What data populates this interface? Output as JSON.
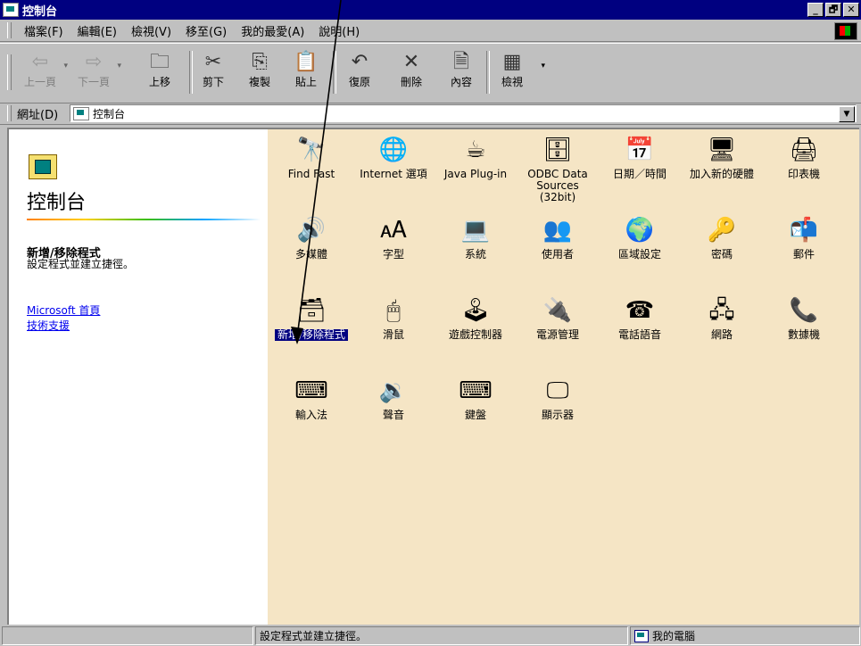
{
  "window": {
    "title": "控制台",
    "buttons": [
      "_",
      "🗗",
      "✕"
    ]
  },
  "menubar": {
    "items": [
      "檔案(F)",
      "編輯(E)",
      "檢視(V)",
      "移至(G)",
      "我的最愛(A)",
      "說明(H)"
    ]
  },
  "toolbar": {
    "back": "上一頁",
    "forward": "下一頁",
    "up": "上移",
    "cut": "剪下",
    "copy": "複製",
    "paste": "貼上",
    "undo": "復原",
    "delete": "刪除",
    "properties": "內容",
    "views": "檢視"
  },
  "address": {
    "label": "網址(D)",
    "value": "控制台"
  },
  "leftpane": {
    "title": "控制台",
    "selected_title": "新增/移除程式",
    "selected_desc": "設定程式並建立捷徑。",
    "links": [
      "Microsoft 首頁",
      "技術支援"
    ]
  },
  "icons": [
    {
      "label": "Find Fast",
      "glyph": "🔭",
      "icon": "find-fast-icon"
    },
    {
      "label": "Internet 選項",
      "glyph": "🌐",
      "icon": "internet-options-icon"
    },
    {
      "label": "Java Plug-in",
      "glyph": "☕",
      "icon": "java-plugin-icon"
    },
    {
      "label": "ODBC Data Sources (32bit)",
      "glyph": "🗄",
      "icon": "odbc-icon"
    },
    {
      "label": "日期／時間",
      "glyph": "📅",
      "icon": "date-time-icon"
    },
    {
      "label": "加入新的硬體",
      "glyph": "🖥",
      "icon": "add-hardware-icon"
    },
    {
      "label": "印表機",
      "glyph": "🖨",
      "icon": "printers-icon"
    },
    {
      "label": "多媒體",
      "glyph": "🔊",
      "icon": "multimedia-icon"
    },
    {
      "label": "字型",
      "glyph": "🗚",
      "icon": "fonts-icon"
    },
    {
      "label": "系統",
      "glyph": "💻",
      "icon": "system-icon"
    },
    {
      "label": "使用者",
      "glyph": "👥",
      "icon": "users-icon"
    },
    {
      "label": "區域設定",
      "glyph": "🌍",
      "icon": "regional-settings-icon"
    },
    {
      "label": "密碼",
      "glyph": "🔑",
      "icon": "passwords-icon"
    },
    {
      "label": "郵件",
      "glyph": "📬",
      "icon": "mail-icon"
    },
    {
      "label": "新增/移除程式",
      "glyph": "🗃",
      "icon": "add-remove-programs-icon",
      "selected": true
    },
    {
      "label": "滑鼠",
      "glyph": "🖱",
      "icon": "mouse-icon"
    },
    {
      "label": "遊戲控制器",
      "glyph": "🕹",
      "icon": "game-controllers-icon"
    },
    {
      "label": "電源管理",
      "glyph": "🔌",
      "icon": "power-management-icon"
    },
    {
      "label": "電話語音",
      "glyph": "☎",
      "icon": "telephony-icon"
    },
    {
      "label": "網路",
      "glyph": "🖧",
      "icon": "network-icon"
    },
    {
      "label": "數據機",
      "glyph": "📞",
      "icon": "modems-icon"
    },
    {
      "label": "輸入法",
      "glyph": "⌨",
      "icon": "input-method-icon"
    },
    {
      "label": "聲音",
      "glyph": "🔉",
      "icon": "sounds-icon"
    },
    {
      "label": "鍵盤",
      "glyph": "⌨",
      "icon": "keyboard-icon"
    },
    {
      "label": "顯示器",
      "glyph": "🖵",
      "icon": "display-icon"
    }
  ],
  "statusbar": {
    "text": "設定程式並建立捷徑。",
    "zone": "我的電腦"
  }
}
